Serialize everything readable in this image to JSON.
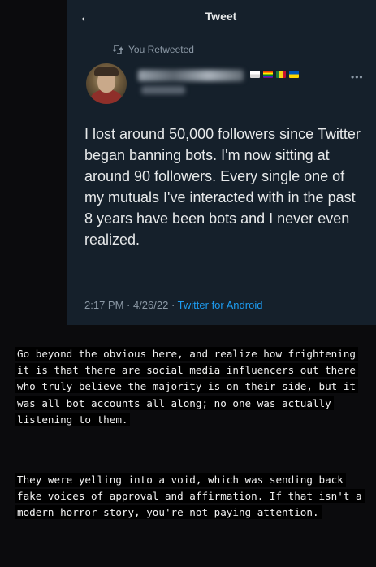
{
  "header": {
    "title": "Tweet"
  },
  "retweet": {
    "label": "You Retweeted"
  },
  "tweet": {
    "text": "I lost around 50,000 followers since Twitter began banning bots. I'm now sitting at around 90 followers. Every single one of my mutuals I've interacted with in the past 8 years have been bots and I never even realized.",
    "timestamp": "2:17 PM · 4/26/22 · ",
    "source": "Twitter for Android"
  },
  "commentary": {
    "paragraph1": "Go beyond the obvious here, and realize how frightening it is that there are social media influencers out there who truly believe the majority is on their side, but it was all bot accounts all along; no one was actually listening to them.",
    "paragraph2": "They were yelling into a void, which was sending back fake voices of approval and affirmation. If that isn't a modern horror story, you're not paying attention."
  },
  "colors": {
    "tweet_background": "#15202b",
    "primary_text": "#e7e9ea",
    "secondary_text": "#8b98a5",
    "link": "#1d9bf0",
    "page_background": "#0b0b0d"
  },
  "icons": {
    "back": "back-arrow-icon",
    "retweet": "retweet-icon",
    "more": "more-icon"
  }
}
